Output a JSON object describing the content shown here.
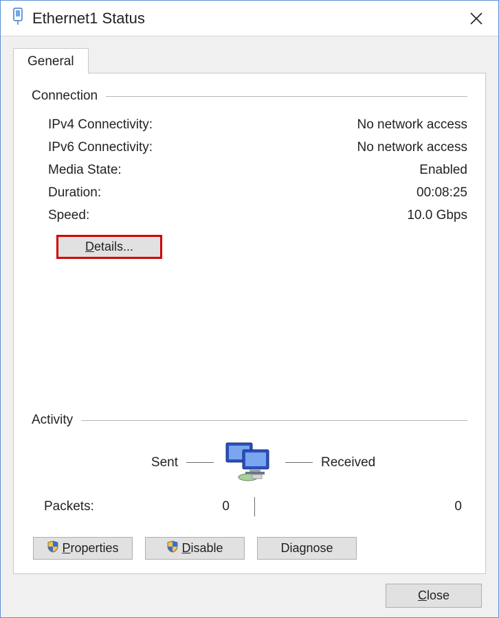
{
  "window": {
    "title": "Ethernet1 Status"
  },
  "tab": {
    "general": "General"
  },
  "connection": {
    "title": "Connection",
    "ipv4_label": "IPv4 Connectivity:",
    "ipv4_value": "No network access",
    "ipv6_label": "IPv6 Connectivity:",
    "ipv6_value": "No network access",
    "media_state_label": "Media State:",
    "media_state_value": "Enabled",
    "duration_label": "Duration:",
    "duration_value": "00:08:25",
    "speed_label": "Speed:",
    "speed_value": "10.0 Gbps",
    "details_button": "etails..."
  },
  "activity": {
    "title": "Activity",
    "sent_label": "Sent",
    "received_label": "Received",
    "packets_label": "Packets:",
    "sent_value": "0",
    "received_value": "0"
  },
  "buttons": {
    "properties": "roperties",
    "disable": "isable",
    "diagnose": "Dia",
    "diagnose2": "nose",
    "close": "lose"
  }
}
